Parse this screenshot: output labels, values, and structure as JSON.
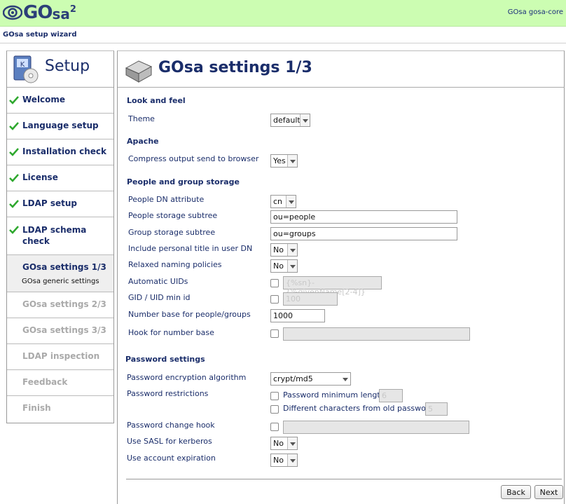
{
  "header": {
    "logo_text_go": "GO",
    "logo_text_sa": "sa",
    "logo_sup": "2",
    "version": "GOsa gosa-core",
    "accent_color": "#ccfdb2",
    "brand_color": "#1a2d6a"
  },
  "subbar": {
    "title": "GOsa setup wizard"
  },
  "sidebar": {
    "title": "Setup",
    "items": [
      {
        "label": "Welcome",
        "state": "done"
      },
      {
        "label": "Language setup",
        "state": "done"
      },
      {
        "label": "Installation check",
        "state": "done"
      },
      {
        "label": "License",
        "state": "done"
      },
      {
        "label": "LDAP setup",
        "state": "done"
      },
      {
        "label": "LDAP schema check",
        "state": "done"
      },
      {
        "label": "GOsa settings 1/3",
        "state": "active",
        "sub": "GOsa generic settings"
      },
      {
        "label": "GOsa settings 2/3",
        "state": "disabled"
      },
      {
        "label": "GOsa settings 3/3",
        "state": "disabled"
      },
      {
        "label": "LDAP inspection",
        "state": "disabled"
      },
      {
        "label": "Feedback",
        "state": "disabled"
      },
      {
        "label": "Finish",
        "state": "disabled"
      }
    ]
  },
  "main": {
    "title": "GOsa settings 1/3",
    "look_and_feel": {
      "heading": "Look and feel",
      "theme_label": "Theme",
      "theme_value": "default"
    },
    "apache": {
      "heading": "Apache",
      "compress_label": "Compress output send to browser",
      "compress_value": "Yes"
    },
    "storage": {
      "heading": "People and group storage",
      "people_dn_label": "People DN attribute",
      "people_dn_value": "cn",
      "people_subtree_label": "People storage subtree",
      "people_subtree_value": "ou=people",
      "group_subtree_label": "Group storage subtree",
      "group_subtree_value": "ou=groups",
      "personal_title_label": "Include personal title in user DN",
      "personal_title_value": "No",
      "relaxed_label": "Relaxed naming policies",
      "relaxed_value": "No",
      "auto_uids_label": "Automatic UIDs",
      "auto_uids_value": "{%sn}-{%givenName[2-4]}",
      "gid_uid_label": "GID / UID min id",
      "gid_uid_value": "100",
      "number_base_label": "Number base for people/groups",
      "number_base_value": "1000",
      "hook_label": "Hook for number base",
      "hook_value": ""
    },
    "password": {
      "heading": "Password settings",
      "algo_label": "Password encryption algorithm",
      "algo_value": "crypt/md5",
      "restrictions_label": "Password restrictions",
      "min_length_label": "Password minimum length",
      "min_length_value": "6",
      "diff_chars_label": "Different characters from old password",
      "diff_chars_value": "5",
      "change_hook_label": "Password change hook",
      "change_hook_value": "",
      "sasl_label": "Use SASL for kerberos",
      "sasl_value": "No",
      "expiration_label": "Use account expiration",
      "expiration_value": "No"
    },
    "buttons": {
      "back": "Back",
      "next": "Next"
    }
  }
}
